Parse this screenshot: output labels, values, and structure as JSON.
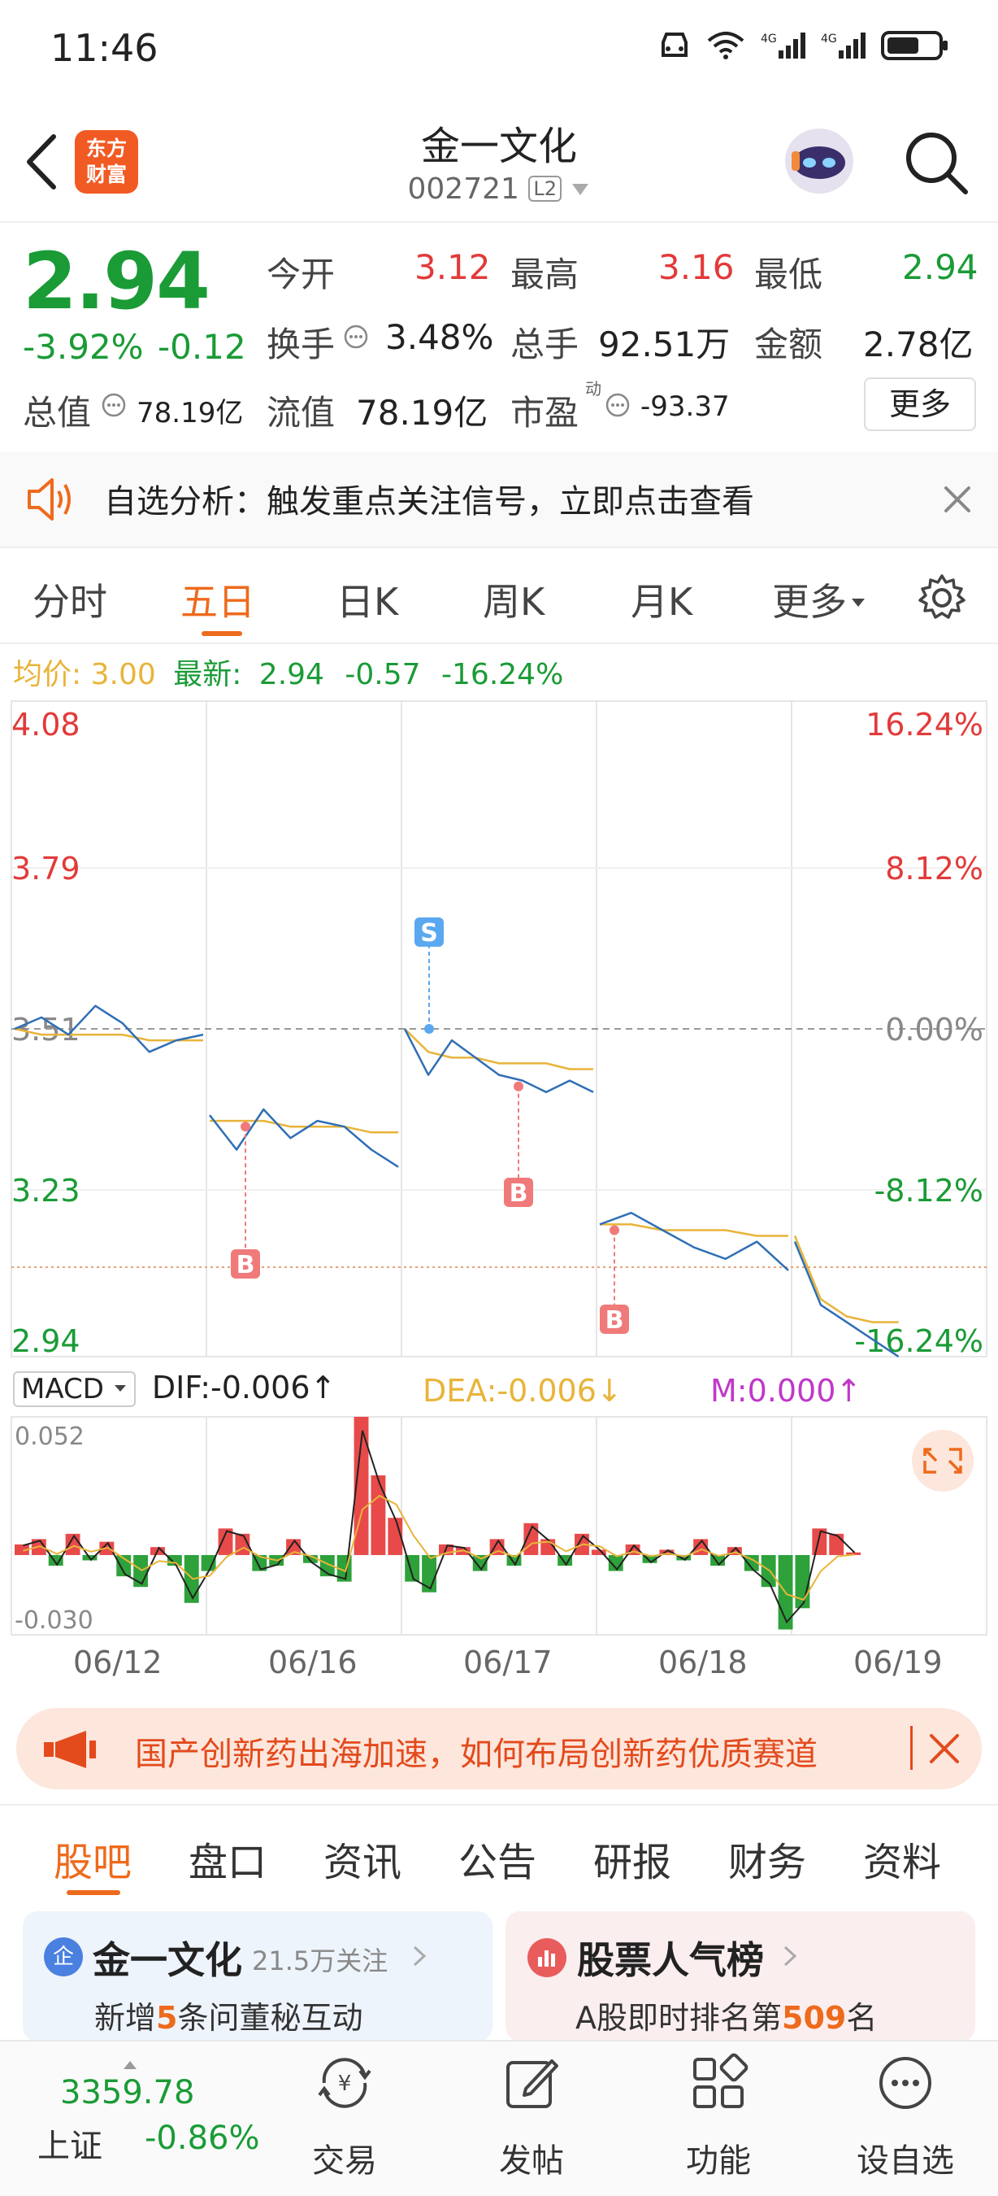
{
  "status_bar": {
    "time": "11:46"
  },
  "header": {
    "back_label": "back",
    "logo_line1": "东方",
    "logo_line2": "财富",
    "title": "金一文化",
    "code": "002721",
    "level_badge": "L2"
  },
  "quote": {
    "price": "2.94",
    "change_pct": "-3.92%",
    "change_amt": "-0.12",
    "open_label": "今开",
    "open": "3.12",
    "high_label": "最高",
    "high": "3.16",
    "low_label": "最低",
    "low": "2.94",
    "turnover_label": "换手",
    "turnover": "3.48%",
    "volume_label": "总手",
    "volume": "92.51万",
    "amount_label": "金额",
    "amount": "2.78亿",
    "mktcap_label": "总值",
    "mktcap": "78.19亿",
    "float_label": "流值",
    "float_cap": "78.19亿",
    "pe_label": "市盈",
    "pe_sup": "动",
    "pe": "-93.37",
    "more_button": "更多"
  },
  "notice": {
    "text": "自选分析：触发重点关注信号，立即点击查看"
  },
  "chart_tabs": [
    {
      "label": "分时"
    },
    {
      "label": "五日"
    },
    {
      "label": "日K"
    },
    {
      "label": "周K"
    },
    {
      "label": "月K"
    },
    {
      "label": "更多"
    }
  ],
  "avg_line": {
    "avg_label": "均价:",
    "avg_value": "3.00",
    "latest_label": "最新:",
    "latest_value": "2.94",
    "change": "-0.57",
    "change_pct": "-16.24%"
  },
  "chart_data": {
    "type": "line",
    "x_labels": [
      "06/12",
      "06/16",
      "06/17",
      "06/18",
      "06/19"
    ],
    "y_left_ticks": [
      "4.08",
      "3.79",
      "3.51",
      "3.23",
      "2.94"
    ],
    "y_right_ticks": [
      "16.24%",
      "8.12%",
      "0.00%",
      "-8.12%",
      "-16.24%"
    ],
    "ylim": [
      2.94,
      4.08
    ],
    "reference_price": 3.51,
    "marker_labels": {
      "sell": "S",
      "buy": "B"
    },
    "series": [
      {
        "values": [
          3.51,
          3.53,
          3.5,
          3.55,
          3.52,
          3.47,
          3.49,
          3.5,
          3.36,
          3.3,
          3.37,
          3.32,
          3.35,
          3.34,
          3.3,
          3.27,
          3.51,
          3.43,
          3.49,
          3.46,
          3.43,
          3.42,
          3.4,
          3.42,
          3.4,
          3.17,
          3.19,
          3.16,
          3.13,
          3.11,
          3.14,
          3.09,
          3.14,
          3.03,
          3.0,
          2.97,
          2.94
        ]
      },
      {
        "values": [
          3.51,
          3.5,
          3.5,
          3.5,
          3.5,
          3.49,
          3.49,
          3.49,
          3.35,
          3.35,
          3.35,
          3.34,
          3.34,
          3.34,
          3.33,
          3.33,
          3.51,
          3.47,
          3.46,
          3.46,
          3.45,
          3.45,
          3.45,
          3.44,
          3.44,
          3.17,
          3.17,
          3.16,
          3.16,
          3.16,
          3.15,
          3.15,
          3.15,
          3.04,
          3.01,
          3.0,
          3.0
        ]
      }
    ],
    "macd": {
      "label": "MACD",
      "dif": "DIF:-0.006↑",
      "dea": "DEA:-0.006↓",
      "m": "M:0.000↑",
      "max_label": "0.052",
      "min_label": "-0.030",
      "ylim": [
        -0.03,
        0.052
      ],
      "bars": [
        0.004,
        0.006,
        -0.004,
        0.008,
        -0.002,
        0.005,
        -0.008,
        -0.012,
        0.003,
        -0.004,
        -0.018,
        -0.006,
        0.01,
        0.008,
        -0.006,
        -0.004,
        0.006,
        -0.003,
        -0.008,
        -0.01,
        0.052,
        0.03,
        0.014,
        -0.01,
        -0.014,
        0.004,
        0.003,
        -0.006,
        0.006,
        -0.004,
        0.012,
        0.006,
        -0.004,
        0.008,
        0.002,
        -0.006,
        0.004,
        -0.003,
        0.002,
        -0.002,
        0.006,
        -0.004,
        0.003,
        -0.006,
        -0.012,
        -0.028,
        -0.02,
        0.01,
        0.008,
        0.001
      ]
    }
  },
  "banner": {
    "text": "国产创新药出海加速，如何布局创新药优质赛道"
  },
  "bottom_tabs": [
    {
      "label": "股吧"
    },
    {
      "label": "盘口"
    },
    {
      "label": "资讯"
    },
    {
      "label": "公告"
    },
    {
      "label": "研报"
    },
    {
      "label": "财务"
    },
    {
      "label": "资料"
    }
  ],
  "cards": {
    "left_title": "金一文化",
    "left_followers": "21.5万关注",
    "left_sub_pre": "新增",
    "left_sub_num": "5",
    "left_sub_post": "条问董秘互动",
    "left_badge": "企",
    "right_title": "股票人气榜",
    "right_sub_pre": "A股即时排名第",
    "right_sub_num": "509",
    "right_sub_post": "名"
  },
  "bottom_nav": {
    "index_value": "3359.78",
    "index_name": "上证",
    "index_change": "-0.86%",
    "items": [
      {
        "label": "交易"
      },
      {
        "label": "发帖"
      },
      {
        "label": "功能"
      },
      {
        "label": "设自选"
      }
    ]
  }
}
